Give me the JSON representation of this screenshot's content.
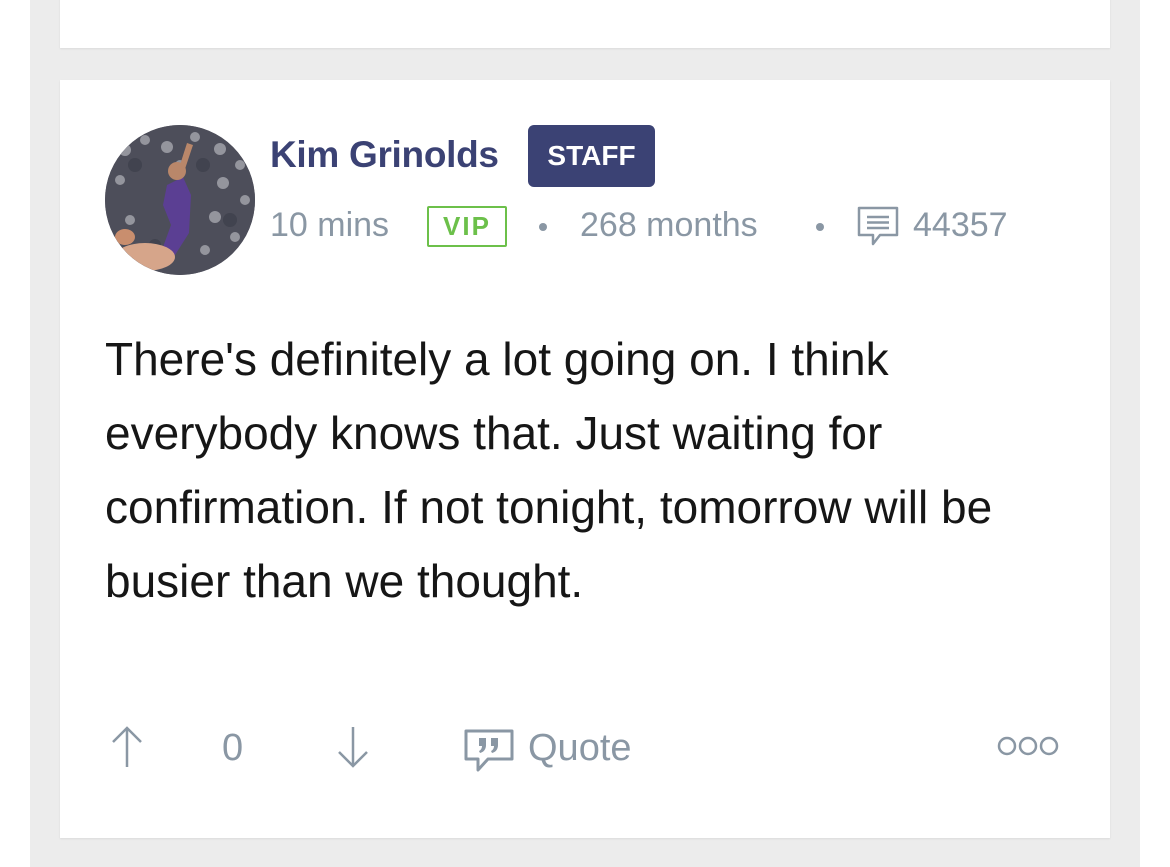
{
  "post": {
    "author": {
      "name": "Kim Grinolds",
      "role_badge": "STAFF",
      "avatar_icon": "user-avatar-photo"
    },
    "meta": {
      "posted_ago": "10 mins",
      "membership_badge": "VIP",
      "member_duration": "268 months",
      "post_count": "44357",
      "post_count_icon": "comment-icon"
    },
    "body": "There's definitely a lot going on. I think everybody knows that. Just waiting for confirmation. If not tonight, tomorrow will be busier than we thought.",
    "actions": {
      "vote_count": "0",
      "quote_label": "Quote",
      "upvote_icon": "arrow-up-icon",
      "downvote_icon": "arrow-down-icon",
      "quote_icon": "quote-bubble-icon",
      "more_icon": "more-options-icon"
    }
  },
  "colors": {
    "author_name": "#3b4274",
    "staff_badge_bg": "#3b4274",
    "vip_green": "#6cc04a",
    "meta_gray": "#8a97a4",
    "body_text": "#161616",
    "page_bg": "#ececec"
  }
}
